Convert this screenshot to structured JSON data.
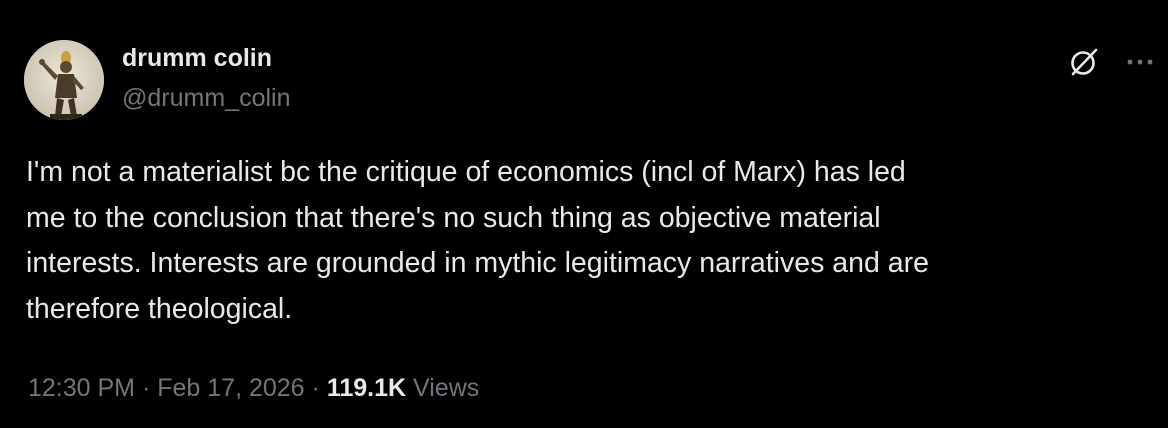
{
  "author": {
    "display_name": "drumm colin",
    "handle": "@drumm_colin"
  },
  "tweet": {
    "text_lines": [
      "I'm not a materialist bc the critique of economics (incl of Marx) has led",
      "me to the conclusion that there's no such thing as objective material",
      "interests. Interests are grounded in mythic legitimacy narratives and are",
      "therefore theological."
    ]
  },
  "meta": {
    "time": "12:30 PM",
    "separator": "·",
    "date": "Feb 17, 2026",
    "views_count": "119.1K",
    "views_label": "Views"
  },
  "icons": {
    "grok": "grok-icon",
    "more": "more-icon"
  },
  "colors": {
    "background": "#000000",
    "primary_text": "#e7e9ea",
    "secondary_text": "#71767b"
  }
}
